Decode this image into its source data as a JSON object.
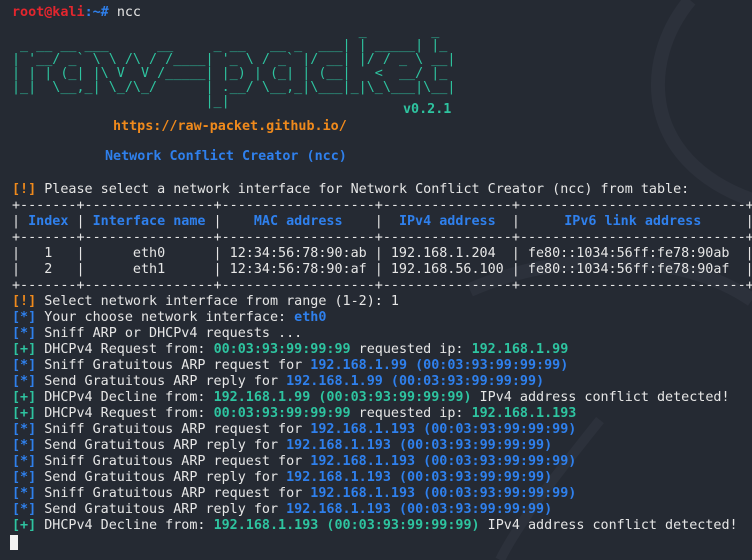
{
  "prompt": {
    "user_host": "root@kali",
    "sep": ":~# ",
    "command": "ncc"
  },
  "banner": {
    "art": [
      "                                           _        _   ",
      " _ __ __ ___      __     _ __   __ _  ___| | _____| |_ ",
      "| '__/ _` \\ \\ /\\ / /____| '_ \\ / _` |/ __| |/ / _ \\ __|",
      "| | | (_| |\\ V  V /_____| |_) | (_| | (__|   <  __/ |_ ",
      "|_|  \\__,_| \\_/\\_/      | .__/ \\__,_|\\___|_|\\_\\___|\\__|",
      "                        |_|                            "
    ],
    "version": "v0.2.1",
    "url": "https://raw-packet.github.io/",
    "subtitle": "Network Conflict Creator (ncc)"
  },
  "intro_line": [
    {
      "t": "[!]",
      "c": "orange"
    },
    {
      "t": " Please select a network interface for Network Conflict Creator (ncc) from table:",
      "c": "white"
    }
  ],
  "table": {
    "headers": [
      "Index",
      "Interface name",
      "MAC address",
      "IPv4 address",
      "IPv6 link address"
    ],
    "rows": [
      [
        "1",
        "eth0",
        "12:34:56:78:90:ab",
        "192.168.1.204",
        "fe80::1034:56ff:fe78:90ab"
      ],
      [
        "2",
        "eth1",
        "12:34:56:78:90:af",
        "192.168.56.100",
        "fe80::1034:56ff:fe78:90af"
      ]
    ]
  },
  "log": [
    [
      {
        "t": "[!]",
        "c": "orange"
      },
      {
        "t": " Select network interface from range (1-2): 1",
        "c": "white"
      }
    ],
    [
      {
        "t": "[*]",
        "c": "blue"
      },
      {
        "t": " Your choose network interface: ",
        "c": "white"
      },
      {
        "t": "eth0",
        "c": "blue"
      }
    ],
    [
      {
        "t": "[*]",
        "c": "blue"
      },
      {
        "t": " Sniff ARP or DHCPv4 requests ...",
        "c": "white"
      }
    ],
    [
      {
        "t": "[+]",
        "c": "green"
      },
      {
        "t": " DHCPv4 Request from: ",
        "c": "white"
      },
      {
        "t": "00:03:93:99:99:99",
        "c": "green"
      },
      {
        "t": " requested ip: ",
        "c": "white"
      },
      {
        "t": "192.168.1.99",
        "c": "green"
      }
    ],
    [
      {
        "t": "[*]",
        "c": "blue"
      },
      {
        "t": " Sniff Gratuitous ARP request for ",
        "c": "white"
      },
      {
        "t": "192.168.1.99 (00:03:93:99:99:99)",
        "c": "blue"
      }
    ],
    [
      {
        "t": "[*]",
        "c": "blue"
      },
      {
        "t": " Send Gratuitous ARP reply for ",
        "c": "white"
      },
      {
        "t": "192.168.1.99 (00:03:93:99:99:99)",
        "c": "blue"
      }
    ],
    [
      {
        "t": "[+]",
        "c": "green"
      },
      {
        "t": " DHCPv4 Decline from: ",
        "c": "white"
      },
      {
        "t": "192.168.1.99 (00:03:93:99:99:99)",
        "c": "green"
      },
      {
        "t": " IPv4 address conflict detected!",
        "c": "white"
      }
    ],
    [
      {
        "t": "[+]",
        "c": "green"
      },
      {
        "t": " DHCPv4 Request from: ",
        "c": "white"
      },
      {
        "t": "00:03:93:99:99:99",
        "c": "green"
      },
      {
        "t": " requested ip: ",
        "c": "white"
      },
      {
        "t": "192.168.1.193",
        "c": "green"
      }
    ],
    [
      {
        "t": "[*]",
        "c": "blue"
      },
      {
        "t": " Sniff Gratuitous ARP request for ",
        "c": "white"
      },
      {
        "t": "192.168.1.193 (00:03:93:99:99:99)",
        "c": "blue"
      }
    ],
    [
      {
        "t": "[*]",
        "c": "blue"
      },
      {
        "t": " Send Gratuitous ARP reply for ",
        "c": "white"
      },
      {
        "t": "192.168.1.193 (00:03:93:99:99:99)",
        "c": "blue"
      }
    ],
    [
      {
        "t": "[*]",
        "c": "blue"
      },
      {
        "t": " Sniff Gratuitous ARP request for ",
        "c": "white"
      },
      {
        "t": "192.168.1.193 (00:03:93:99:99:99)",
        "c": "blue"
      }
    ],
    [
      {
        "t": "[*]",
        "c": "blue"
      },
      {
        "t": " Send Gratuitous ARP reply for ",
        "c": "white"
      },
      {
        "t": "192.168.1.193 (00:03:93:99:99:99)",
        "c": "blue"
      }
    ],
    [
      {
        "t": "[*]",
        "c": "blue"
      },
      {
        "t": " Sniff Gratuitous ARP request for ",
        "c": "white"
      },
      {
        "t": "192.168.1.193 (00:03:93:99:99:99)",
        "c": "blue"
      }
    ],
    [
      {
        "t": "[*]",
        "c": "blue"
      },
      {
        "t": " Send Gratuitous ARP reply for ",
        "c": "white"
      },
      {
        "t": "192.168.1.193 (00:03:93:99:99:99)",
        "c": "blue"
      }
    ],
    [
      {
        "t": "[+]",
        "c": "green"
      },
      {
        "t": " DHCPv4 Decline from: ",
        "c": "white"
      },
      {
        "t": "192.168.1.193 (00:03:93:99:99:99)",
        "c": "green"
      },
      {
        "t": " IPv4 address conflict detected!",
        "c": "white"
      }
    ]
  ],
  "colors": {
    "background": "#252a33",
    "red": "#e3262e",
    "blue": "#2f80ed",
    "green": "#2ec4a0",
    "orange": "#f08a1c"
  }
}
